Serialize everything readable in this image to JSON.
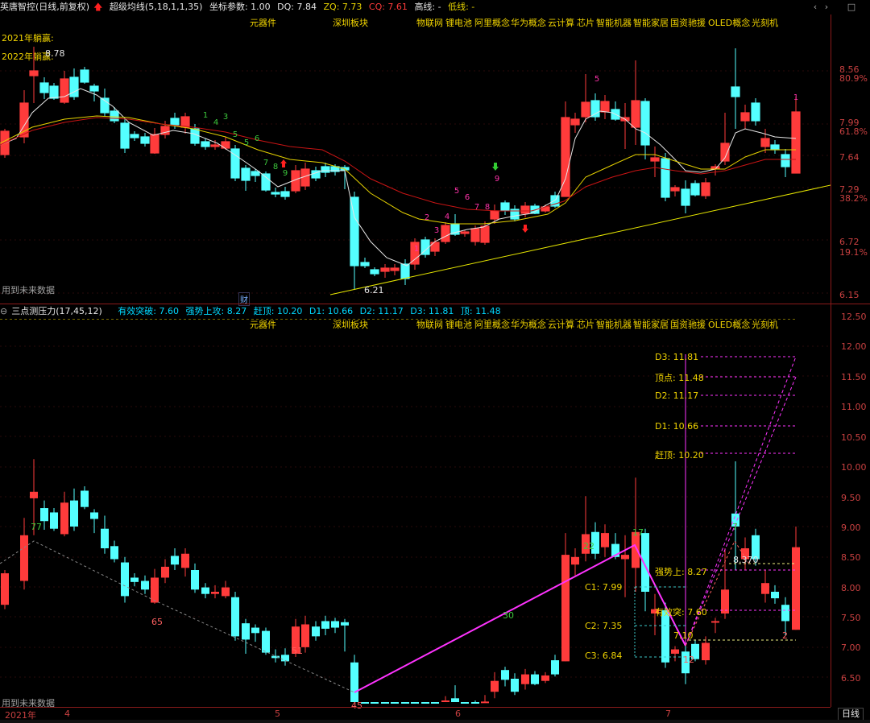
{
  "header": {
    "stock_name": "英唐智控(日线,前复权)",
    "indicator_name": "超级均线(5,18,1,1,35)",
    "coord_param": "坐标参数: 1.00",
    "dq": "DQ: 7.84",
    "zq": "ZQ: 7.73",
    "cq": "CQ: 7.61",
    "high_line": "高线: -",
    "low_line": "低线: -",
    "win_buttons": [
      "‹",
      "›",
      "□"
    ]
  },
  "upper_panel": {
    "tags": [
      "元器件",
      "深圳板块",
      "物联网",
      "锂电池",
      "阿里概念",
      "华为概念",
      "云计算",
      "芯片",
      "智能机器",
      "智能家居",
      "国资驰援",
      "OLED概念",
      "光刻机"
    ],
    "year_notes": [
      "2021年躺赢:",
      "2022年躺赢:"
    ],
    "high_label": "8.78",
    "low_label": "6.21",
    "future_data": "用到未来数据",
    "cai_badge": "财",
    "price_ticks": [
      "8.56",
      "7.99",
      "7.64",
      "7.29",
      "6.72",
      "6.15"
    ],
    "pct_ticks": [
      "80.9%",
      "61.8%",
      "38.2%",
      "19.1%"
    ],
    "counts": [
      "1",
      "3",
      "4",
      "5",
      "6",
      "7",
      "8",
      "9",
      "1",
      "2",
      "3",
      "4",
      "5",
      "6",
      "7",
      "8",
      "9",
      "5"
    ]
  },
  "lower_panel": {
    "title": "三点测压力(17,45,12)",
    "fields": [
      {
        "label": "有效突破: 7.60",
        "color": "#00d8ff"
      },
      {
        "label": "强势上攻: 8.27",
        "color": "#00d8ff"
      },
      {
        "label": "赶顶: 10.20",
        "color": "#00d8ff"
      },
      {
        "label": "D1: 10.66",
        "color": "#00d8ff"
      },
      {
        "label": "D2: 11.17",
        "color": "#00d8ff"
      },
      {
        "label": "D3: 11.81",
        "color": "#00d8ff"
      },
      {
        "label": "顶: 11.48",
        "color": "#00d8ff"
      }
    ],
    "tags": [
      "元器件",
      "深圳板块",
      "物联网",
      "锂电池",
      "阿里概念",
      "华为概念",
      "云计算",
      "芯片",
      "智能机器",
      "智能家居",
      "国资驰援",
      "OLED概念",
      "光刻机"
    ],
    "price_ticks": [
      "12.50",
      "12.00",
      "11.50",
      "11.00",
      "10.50",
      "10.00",
      "9.50",
      "9.00",
      "8.50",
      "8.00",
      "7.50",
      "7.00",
      "6.50"
    ],
    "levels": [
      {
        "label": "D3: 11.81",
        "color": "#f0d300"
      },
      {
        "label": "顶点: 11.48",
        "color": "#f0d300"
      },
      {
        "label": "D2: 11.17",
        "color": "#f0d300"
      },
      {
        "label": "D1: 10.66",
        "color": "#f0d300"
      },
      {
        "label": "赶顶: 10.20",
        "color": "#f0d300"
      },
      {
        "label": "强势上: 8.27",
        "color": "#f0d300"
      },
      {
        "label": "有效突: 7.60",
        "color": "#f0d300"
      }
    ],
    "c_labels": [
      "C1: 7.99",
      "C2: 7.35",
      "C3: 6.84"
    ],
    "point_labels": [
      "77",
      "65",
      "51",
      "45",
      "30",
      "22",
      "17",
      "12",
      "7",
      "2",
      "7.10",
      "8.370"
    ],
    "future_data": "用到未来数据"
  },
  "time_axis": {
    "labels": [
      "2021年",
      "4",
      "5",
      "6",
      "7"
    ],
    "period_button": "日线"
  },
  "colors": {
    "up": "#ff3b3b",
    "down": "#54ffff",
    "ma_white": "#e6e6e6",
    "ma_yellow": "#e6d200",
    "ma_red": "#c81414",
    "trend": "#e6e600",
    "magenta": "#ff33ff"
  }
}
